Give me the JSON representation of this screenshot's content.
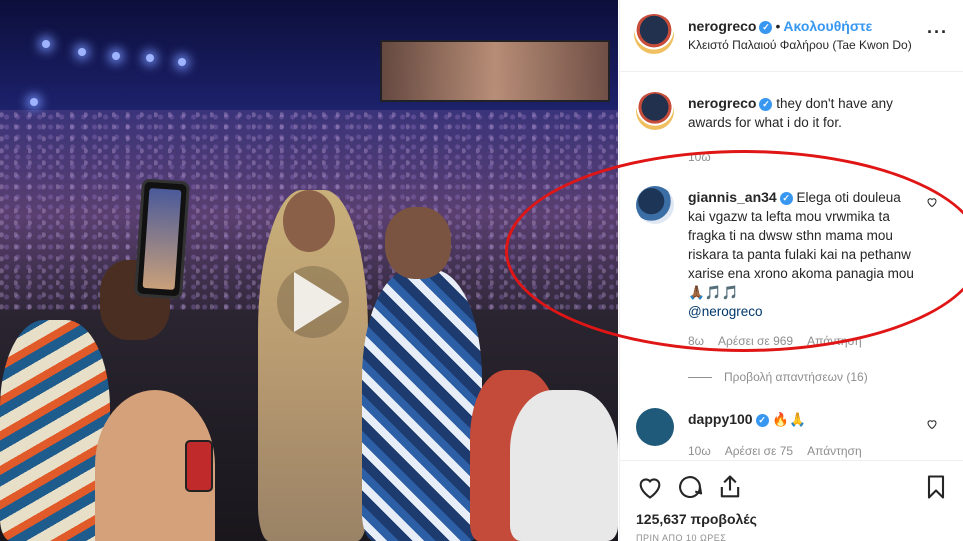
{
  "post": {
    "author": "nerogreco",
    "follow_label": "Ακολουθήστε",
    "dot": "•",
    "location": "Κλειστό Παλαιού Φαλήρου (Tae Kwon Do)",
    "more_label": "···",
    "verified_mark": "✓"
  },
  "caption": {
    "username": "nerogreco",
    "text": "they don't have any awards for what i do it for.",
    "time": "10ω"
  },
  "comments": [
    {
      "username": "giannis_an34",
      "text": "Elega oti douleua kai vgazw ta lefta mou vrwmika ta fragka ti na dwsw sthn mama mou riskara ta panta fulaki kai na pethanw xarise ena xrono akoma panagia mou 🙏🏾🎵🎵",
      "mention": "@nerogreco",
      "time": "8ω",
      "likes": "Αρέσει σε 969",
      "reply": "Απάντηση",
      "view_replies": "Προβολή απαντήσεων (16)"
    },
    {
      "username": "dappy100",
      "text": "🔥🙏",
      "time": "10ω",
      "likes": "Αρέσει σε 75",
      "reply": "Απάντηση"
    }
  ],
  "stats": {
    "views": "125,637 προβολές",
    "posted": "ΠΡΙΝ ΑΠΟ 10 ΩΡΕΣ"
  },
  "icons": [
    "heart-icon",
    "comment-icon",
    "share-icon",
    "bookmark-icon",
    "play-icon",
    "verified-badge-icon"
  ],
  "colors": {
    "accent": "#3897f0",
    "annotation": "#e01515",
    "muted": "#8e8e8e"
  }
}
